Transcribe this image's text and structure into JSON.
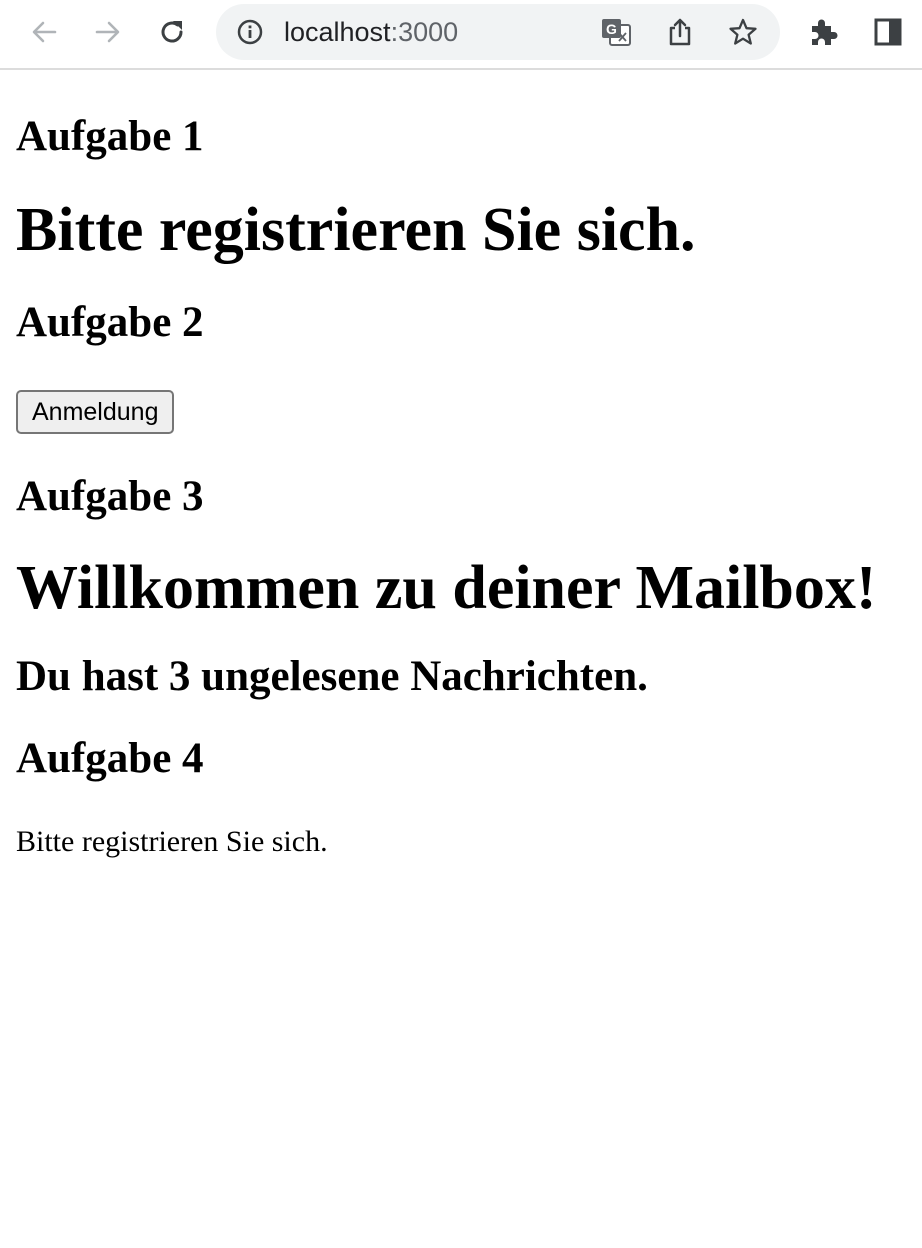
{
  "browser": {
    "url_host": "localhost",
    "url_port": ":3000",
    "icons": {
      "back": "arrow-left-icon",
      "forward": "arrow-right-icon",
      "reload": "reload-icon",
      "site_info": "info-icon",
      "translate": "translate-icon",
      "share": "share-icon",
      "bookmark": "star-icon",
      "extensions": "puzzle-icon",
      "side_panel": "side-panel-icon"
    }
  },
  "page": {
    "task1_heading": "Aufgabe 1",
    "task1_title": "Bitte registrieren Sie sich.",
    "task2_heading": "Aufgabe 2",
    "task2_button": "Anmeldung",
    "task3_heading": "Aufgabe 3",
    "task3_title": "Willkommen zu deiner Mailbox!",
    "task3_subtitle": "Du hast 3 ungelesene Nachrichten.",
    "task4_heading": "Aufgabe 4",
    "task4_text": "Bitte registrieren Sie sich."
  }
}
